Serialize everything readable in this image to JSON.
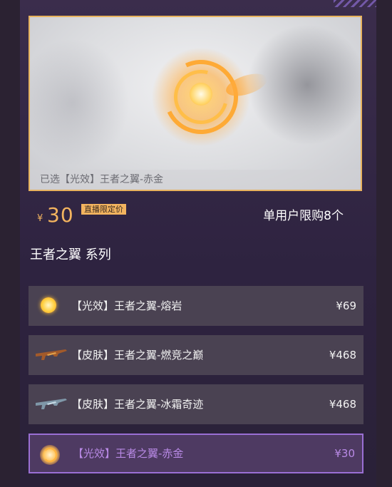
{
  "preview": {
    "caption": "已选【光效】王者之翼-赤金"
  },
  "price": {
    "currency": "¥",
    "amount": "30",
    "badge": "直播限定价"
  },
  "limit_text": "单用户限购8个",
  "series_title": "王者之翼 系列",
  "items": [
    {
      "label": "【光效】王者之翼-熔岩",
      "price": "¥69",
      "icon": "sun-effect-icon"
    },
    {
      "label": "【皮肤】王者之翼-燃竞之巅",
      "price": "¥468",
      "icon": "rifle-skin-icon"
    },
    {
      "label": "【皮肤】王者之翼-冰霜奇迹",
      "price": "¥468",
      "icon": "rifle-skin-icon"
    },
    {
      "label": "【光效】王者之翼-赤金",
      "price": "¥30",
      "icon": "golden-orb-icon",
      "selected": true
    }
  ],
  "colors": {
    "accent_gold": "#f3b45f",
    "selected_purple": "#9a6fd4",
    "panel": "#2e2340"
  }
}
